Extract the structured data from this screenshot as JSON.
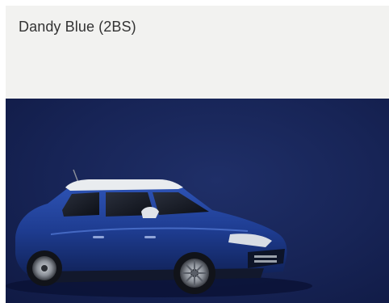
{
  "swatch": {
    "color_name": "Dandy Blue (2BS)",
    "swatch_color": "#18255a",
    "car_color": "#1d3a8c"
  }
}
